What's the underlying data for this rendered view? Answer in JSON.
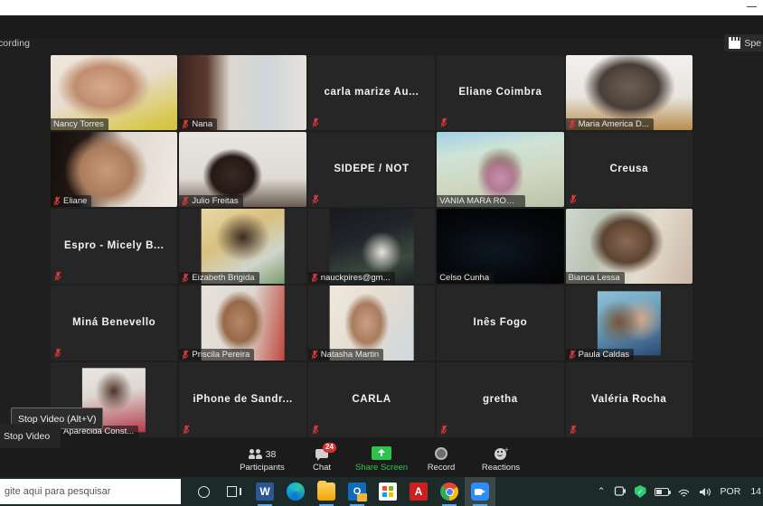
{
  "window": {
    "minimize_icon": "minimize-icon"
  },
  "zoom_header": {
    "recording_label": "ecording",
    "view_button_label": "Spe",
    "view_button_icon": "gallery-grid-icon"
  },
  "gallery": {
    "tiles": [
      {
        "name": "Nancy Torres",
        "type": "video",
        "muted": false,
        "active": false,
        "video": "nancy"
      },
      {
        "name": "Nana",
        "type": "video",
        "muted": true,
        "active": false,
        "video": "nana"
      },
      {
        "name": "carla marize Au...",
        "type": "name-only",
        "muted": true,
        "active": false
      },
      {
        "name": "Eliane Coimbra",
        "type": "name-only",
        "muted": true,
        "active": false
      },
      {
        "name": "Maria America D...",
        "type": "video",
        "muted": true,
        "active": false,
        "video": "maria"
      },
      {
        "name": "Eliane",
        "type": "video",
        "muted": true,
        "active": false,
        "video": "elianev"
      },
      {
        "name": "Julio Freitas",
        "type": "video",
        "muted": true,
        "active": false,
        "video": "julio"
      },
      {
        "name": "SIDEPE / NOT",
        "type": "name-only",
        "muted": true,
        "active": false
      },
      {
        "name": "VANIA MARA RODR...",
        "type": "video",
        "muted": false,
        "active": true,
        "video": "vania"
      },
      {
        "name": "Creusa",
        "type": "name-only",
        "muted": true,
        "active": false
      },
      {
        "name": "Espro - Micely B...",
        "type": "name-only",
        "muted": true,
        "active": false
      },
      {
        "name": "Eizabeth Brigida",
        "type": "inset",
        "muted": true,
        "active": false,
        "video": "eizabeth"
      },
      {
        "name": "nauckpires@gm...",
        "type": "inset",
        "muted": true,
        "active": false,
        "video": "nauck"
      },
      {
        "name": "Celso Cunha",
        "type": "video",
        "muted": false,
        "active": false,
        "video": "celso"
      },
      {
        "name": "Bianca Lessa",
        "type": "video",
        "muted": false,
        "active": false,
        "video": "bianca"
      },
      {
        "name": "Miná Benevello",
        "type": "name-only",
        "muted": true,
        "active": false
      },
      {
        "name": "Priscila Pereira",
        "type": "inset",
        "muted": true,
        "active": false,
        "video": "priscila"
      },
      {
        "name": "Natasha Martin",
        "type": "inset",
        "muted": true,
        "active": false,
        "video": "natasha"
      },
      {
        "name": "Inês Fogo",
        "type": "name-only",
        "muted": false,
        "active": false
      },
      {
        "name": "Paula Caldas",
        "type": "thumb",
        "muted": true,
        "active": false,
        "video": "paula"
      },
      {
        "name": "Aparecida Const...",
        "type": "thumb",
        "muted": true,
        "active": false,
        "video": "aparecida"
      },
      {
        "name": "iPhone de Sandr...",
        "type": "name-only",
        "muted": true,
        "active": false
      },
      {
        "name": "CARLA",
        "type": "name-only",
        "muted": true,
        "active": false
      },
      {
        "name": "gretha",
        "type": "name-only",
        "muted": true,
        "active": false
      },
      {
        "name": "Valéria Rocha",
        "type": "name-only",
        "muted": true,
        "active": false
      }
    ],
    "active_speaker_border_color": "#d9ea3c",
    "mute_icon_color": "#d63a3a"
  },
  "toolbar": {
    "items": [
      {
        "label": "Participants",
        "icon": "participants-icon",
        "count": "38",
        "badge": null,
        "accent": null
      },
      {
        "label": "Chat",
        "icon": "chat-icon",
        "count": null,
        "badge": "24",
        "accent": null
      },
      {
        "label": "Share Screen",
        "icon": "share-screen-icon",
        "count": null,
        "badge": null,
        "accent": "#2dc44c"
      },
      {
        "label": "Record",
        "icon": "record-icon",
        "count": null,
        "badge": null,
        "accent": null
      },
      {
        "label": "Reactions",
        "icon": "reactions-icon",
        "count": null,
        "badge": null,
        "accent": null
      }
    ],
    "stop_video_label": "Stop Video",
    "stop_video_tooltip": "Stop Video (Alt+V)"
  },
  "taskbar": {
    "search_placeholder": "gite aqui para pesquisar",
    "apps": [
      {
        "name": "cortana-icon"
      },
      {
        "name": "task-view-icon"
      },
      {
        "name": "word-icon"
      },
      {
        "name": "edge-icon"
      },
      {
        "name": "file-explorer-icon"
      },
      {
        "name": "outlook-icon"
      },
      {
        "name": "microsoft-store-icon"
      },
      {
        "name": "acrobat-reader-icon"
      },
      {
        "name": "chrome-icon"
      },
      {
        "name": "zoom-icon"
      }
    ],
    "tray": {
      "chevron": "⌃",
      "language": "POR",
      "clock": "14"
    }
  }
}
